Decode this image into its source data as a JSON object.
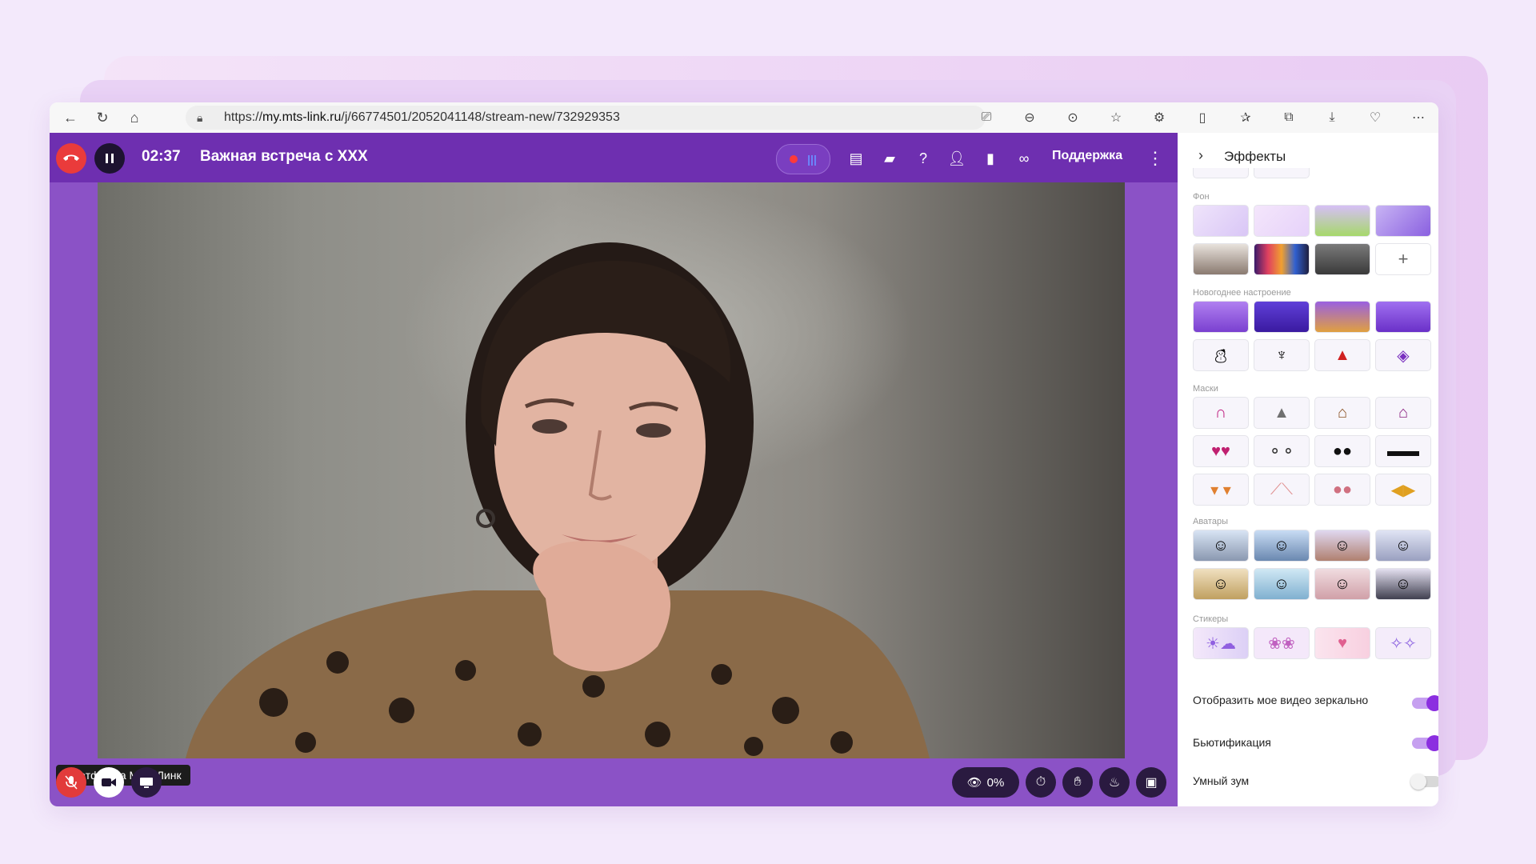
{
  "browser": {
    "url_prefix": "https://",
    "url_domain": "my.mts-link.ru",
    "url_path": "/j/66774501/2052041148/stream-new/732929353",
    "nav_icons": [
      "back-icon",
      "reload-icon",
      "home-icon"
    ],
    "toolbar_icons": [
      "camera-icon",
      "zoom-out-icon",
      "more-circle-icon",
      "star-icon",
      "extensions-icon",
      "split-view-icon",
      "favorites-icon",
      "collections-icon",
      "download-icon",
      "browser-essentials-icon",
      "ellipsis-icon"
    ]
  },
  "meeting": {
    "timer": "02:37",
    "title": "Важная встреча с XXX",
    "support_label": "Поддержка",
    "participant_name": "Платформа МТС Линк",
    "viewers_percent": "0%"
  },
  "colors": {
    "app_bg": "#8b52c6",
    "topbar_bg": "#6e2fb0",
    "end_call": "#ea3b3b",
    "accent": "#8b2ee0"
  },
  "panel": {
    "title": "Эффекты",
    "sections": {
      "background": "Фон",
      "new_year": "Новогоднее настроение",
      "masks": "Маски",
      "avatars": "Аватары",
      "stickers": "Стикеры"
    },
    "add_label": "+",
    "toggles": [
      {
        "label": "Отобразить мое видео зеркально",
        "on": true
      },
      {
        "label": "Бьютификация",
        "on": true
      },
      {
        "label": "Умный зум",
        "on": false
      }
    ]
  }
}
